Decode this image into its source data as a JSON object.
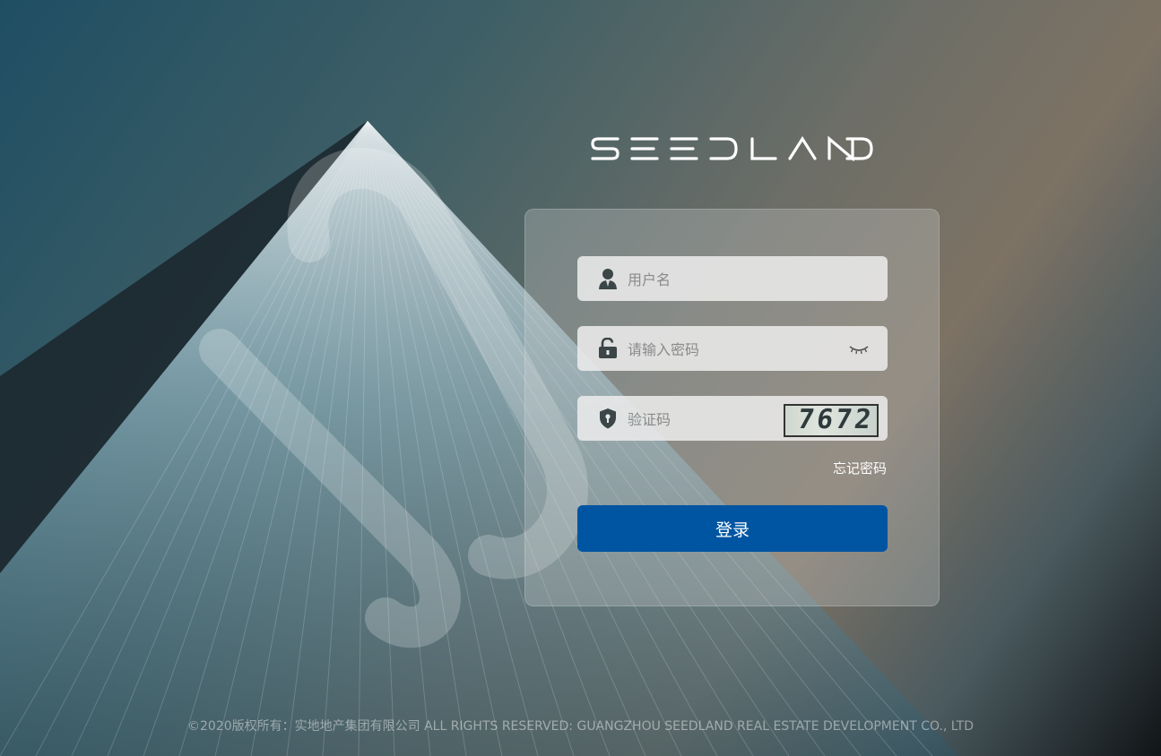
{
  "brand": {
    "logo_text": "SEEDLAND"
  },
  "form": {
    "username_placeholder": "用户名",
    "password_placeholder": "请输入密码",
    "captcha_placeholder": "验证码",
    "captcha_code": "7672",
    "forgot_password": "忘记密码",
    "login_button": "登录"
  },
  "footer": {
    "copyright": "©2020版权所有：实地地产集团有限公司 ALL RIGHTS RESERVED: GUANGZHOU SEEDLAND REAL ESTATE DEVELOPMENT CO., LTD"
  },
  "icons": {
    "username": "user-icon",
    "password": "lock-icon",
    "password_toggle": "eye-closed-icon",
    "captcha": "shield-icon"
  },
  "colors": {
    "accent": "#0055a2"
  }
}
